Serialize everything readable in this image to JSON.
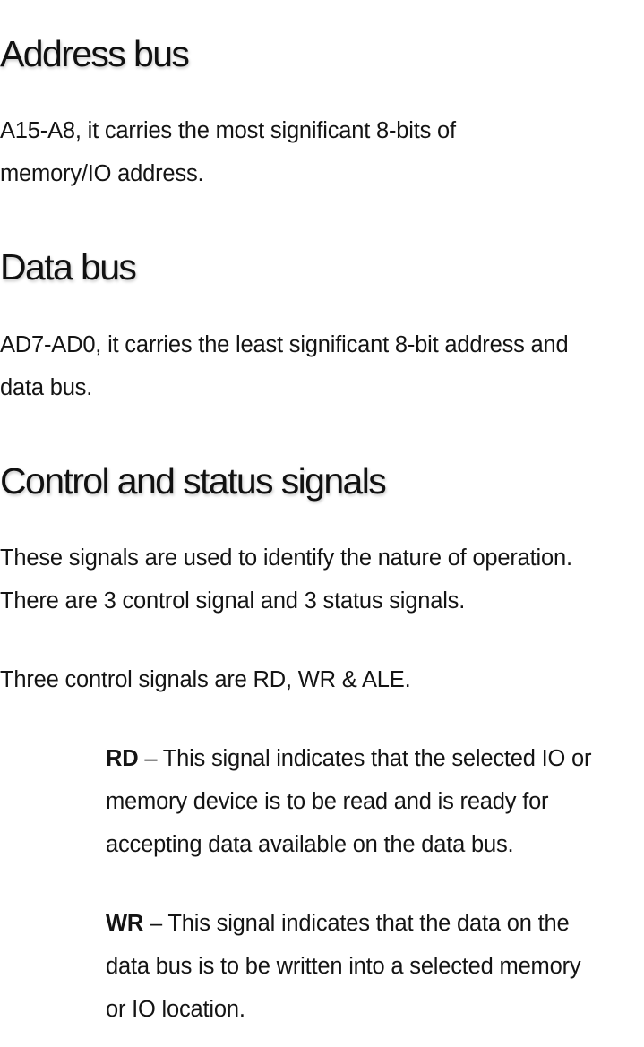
{
  "sections": [
    {
      "heading": "Address bus",
      "paragraphs": [
        {
          "line1": "A15-A8, it carries the most significant 8-bits of",
          "line2": "memory/IO address."
        }
      ]
    },
    {
      "heading": "Data bus",
      "paragraphs": [
        {
          "line1": "AD7-AD0, it carries the least significant 8-bit address and",
          "line2": "data bus."
        }
      ]
    },
    {
      "heading": "Control and status signals",
      "paragraphs": [
        {
          "line1": "These signals are used to identify the nature of operation.",
          "line2": "There are 3 control signal and 3 status signals."
        },
        {
          "line1": "Three control signals are RD, WR & ALE."
        }
      ],
      "signals": [
        {
          "name": "RD",
          "separator": " – ",
          "line1": "This signal indicates that the selected IO or",
          "line2": "memory device is to be read and is ready for",
          "line3": "accepting data available on the data bus."
        },
        {
          "name": "WR",
          "separator": " – ",
          "line1": "This signal indicates that the data on the",
          "line2": "data bus is to be written into a selected memory",
          "line3": "or IO location."
        }
      ]
    }
  ]
}
